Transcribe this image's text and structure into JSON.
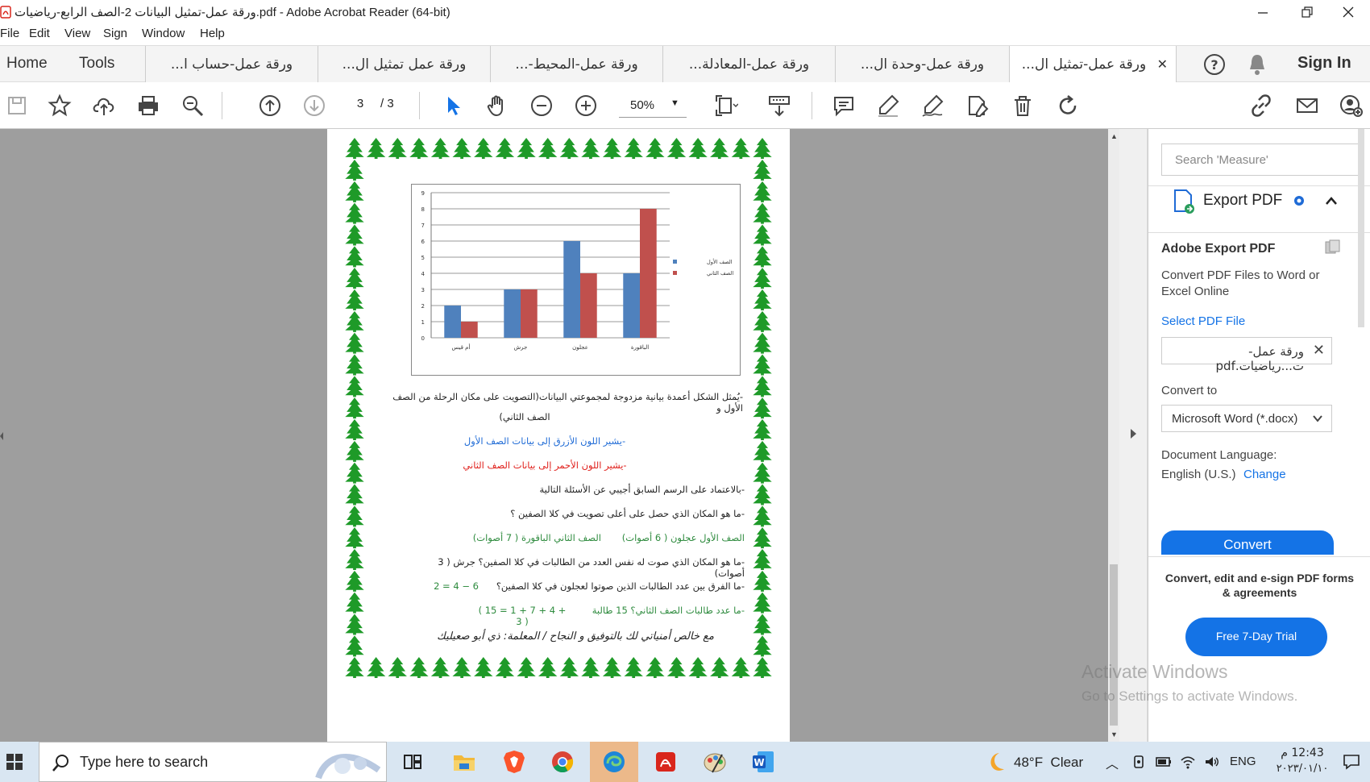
{
  "window": {
    "title": "ورقة عمل-تمثيل البيانات 2-الصف الرابع-رياضيات.pdf - Adobe Acrobat Reader (64-bit)"
  },
  "menu": [
    "File",
    "Edit",
    "View",
    "Sign",
    "Window",
    "Help"
  ],
  "nav": {
    "home": "Home",
    "tools": "Tools"
  },
  "tabs": [
    {
      "label": "ورقة عمل-حساب ا..."
    },
    {
      "label": "ورقة عمل تمثيل ال..."
    },
    {
      "label": "ورقة عمل-المحيط-..."
    },
    {
      "label": "ورقة عمل-المعادلة..."
    },
    {
      "label": "ورقة عمل-وحدة ال..."
    },
    {
      "label": "ورقة عمل-تمثيل ال...",
      "active": true
    }
  ],
  "header_right": {
    "sign_in": "Sign In"
  },
  "toolbar": {
    "page_current": "3",
    "page_total": "/ 3",
    "zoom": "50%"
  },
  "document": {
    "chart_data": {
      "type": "bar",
      "categories": [
        "الباقورة",
        "عجلون",
        "جرش",
        "أم قيس"
      ],
      "series": [
        {
          "name": "الصف الأول",
          "values": [
            4,
            6,
            3,
            2
          ]
        },
        {
          "name": "الصف الثاني",
          "values": [
            8,
            4,
            3,
            1
          ]
        }
      ],
      "ylim": [
        0,
        9
      ],
      "yticks": [
        "0",
        "1",
        "2",
        "3",
        "4",
        "5",
        "6",
        "7",
        "8",
        "9"
      ],
      "grid": true,
      "legend_position": "right",
      "colors": [
        "#4f81bd",
        "#c0504d"
      ]
    },
    "lines": {
      "l1": "-يُمثل الشكل أعمدة بيانية مزدوجة لمجموعتي البيانات(التصويت على مكان الرحلة من الصف الأول و",
      "l1b": "الصف الثاني)",
      "l2": "-يشير اللون الأزرق إلى بيانات الصف الأول",
      "l3": "-يشير اللون الأحمر إلى بيانات الصف الثاني",
      "l4": "-بالاعتماد على الرسم السابق أجيبي عن الأسئلة التالية",
      "l5": "-ما هو المكان الذي حصل على أعلى تصويت في كلا الصفين ؟",
      "l6a": "الصف الأول عجلون ( 6 أصوات)",
      "l6b": "الصف الثاني الباقورة ( 7 أصوات)",
      "l7": "-ما هو المكان الذي صوت له نفس العدد من الطالبات في كلا الصفين؟ جرش ( 3 أصوات)",
      "l8a": "-ما الفرق بين عدد الطالبات الذين صوتوا لعجلون في كلا الصفين؟",
      "l8b": "2 = 4 − 6",
      "l9a": "-ما عدد طالبات الصف الثاني؟ 15 طالبة",
      "l9b": "( 15 = 1 + 7 + 4 + 3 )",
      "sig": "مع خالص أمنياتي لك بالتوفيق و النجاح / المعلمة: ذي أبو صعيليك"
    }
  },
  "right_panel": {
    "search_placeholder": "Search 'Measure'",
    "export_title": "Export PDF",
    "section_title": "Adobe Export PDF",
    "description": "Convert PDF Files to Word or Excel Online",
    "select_file": "Select PDF File",
    "file_name": "ورقة عمل-ت...رياضيات.pdf",
    "convert_to_label": "Convert to",
    "convert_to_value": "Microsoft Word (*.docx)",
    "doc_lang_label": "Document Language:",
    "doc_lang_value": "English (U.S.)",
    "change": "Change",
    "convert_button": "Convert",
    "promo": "Convert, edit and e-sign PDF forms & agreements",
    "trial_button": "Free 7-Day Trial"
  },
  "watermark": {
    "line1": "Activate Windows",
    "line2": "Go to Settings to activate Windows."
  },
  "taskbar": {
    "search_placeholder": "Type here to search",
    "weather": "48°F  Clear",
    "lang": "ENG",
    "time": "12:43 م",
    "date": "٢٠٢٣/٠١/١٠"
  }
}
